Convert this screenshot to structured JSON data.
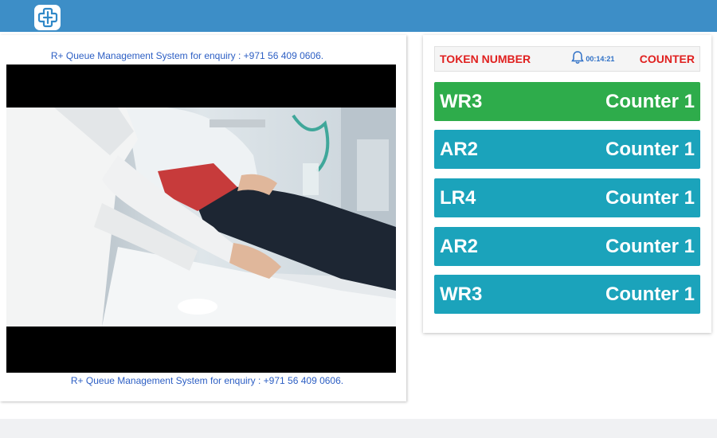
{
  "app": {
    "logo_icon": "medical-cross-logo-icon",
    "brand_color": "#3d8ec7"
  },
  "ticker": {
    "top_text": "R+ Queue Management System for enquiry : +971 56 409 0606.",
    "bottom_text": "R+ Queue Management System for enquiry : +971 56 409 0606."
  },
  "queue": {
    "token_header": "TOKEN NUMBER",
    "counter_header": "COUNTER",
    "clock": "00:14:21",
    "clock_icon": "bell-icon",
    "header_color": "#e0201f",
    "active_color": "#2eac4b",
    "default_color": "#1ba3bb",
    "rows": [
      {
        "token": "WR3",
        "counter": "Counter 1",
        "active": true
      },
      {
        "token": "AR2",
        "counter": "Counter 1",
        "active": false
      },
      {
        "token": "LR4",
        "counter": "Counter 1",
        "active": false
      },
      {
        "token": "AR2",
        "counter": "Counter 1",
        "active": false
      },
      {
        "token": "WR3",
        "counter": "Counter 1",
        "active": false
      }
    ]
  }
}
